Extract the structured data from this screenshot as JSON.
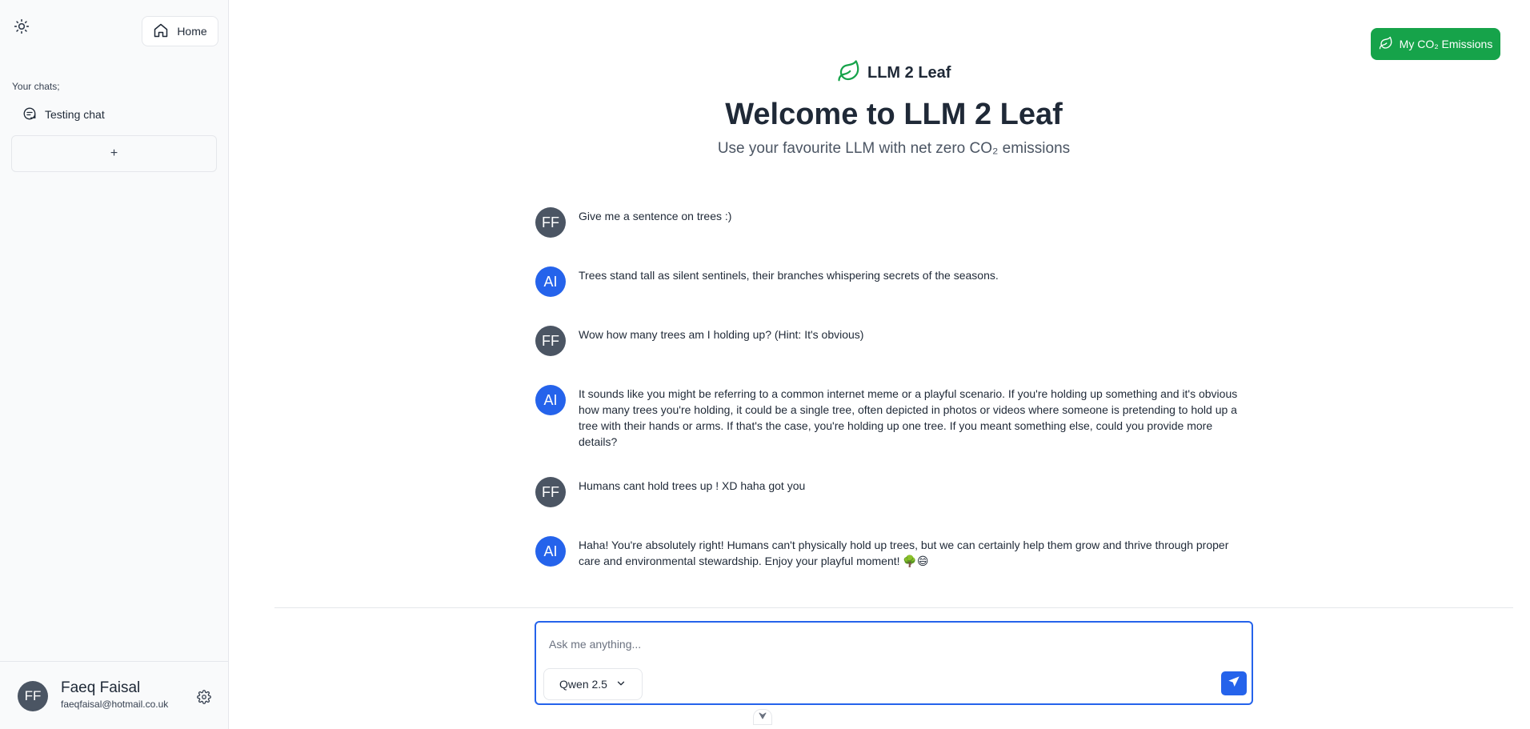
{
  "sidebar": {
    "home_label": "Home",
    "chats_label": "Your chats;",
    "chats": [
      {
        "title": "Testing chat"
      }
    ],
    "new_chat_label": "+",
    "user": {
      "initials": "FF",
      "name": "Faeq Faisal",
      "email": "faeqfaisal@hotmail.co.uk"
    }
  },
  "header": {
    "emissions_label": "My CO₂ Emissions",
    "brand_name": "LLM 2 Leaf",
    "title": "Welcome to LLM 2 Leaf",
    "subtitle": "Use your favourite LLM with net zero CO₂ emissions"
  },
  "messages": [
    {
      "role": "user",
      "avatar": "FF",
      "text": "Give me a sentence on trees :)"
    },
    {
      "role": "ai",
      "avatar": "AI",
      "text": "Trees stand tall as silent sentinels, their branches whispering secrets of the seasons."
    },
    {
      "role": "user",
      "avatar": "FF",
      "text": "Wow how many trees am I holding up? (Hint: It's obvious)"
    },
    {
      "role": "ai",
      "avatar": "AI",
      "text": "It sounds like you might be referring to a common internet meme or a playful scenario. If you're holding up something and it's obvious how many trees you're holding, it could be a single tree, often depicted in photos or videos where someone is pretending to hold up a tree with their hands or arms. If that's the case, you're holding up one tree. If you meant something else, could you provide more details?"
    },
    {
      "role": "user",
      "avatar": "FF",
      "text": "Humans cant hold trees up ! XD haha got you"
    },
    {
      "role": "ai",
      "avatar": "AI",
      "text": "Haha! You're absolutely right! Humans can't physically hold up trees, but we can certainly help them grow and thrive through proper care and environmental stewardship. Enjoy your playful moment! 🌳😄"
    }
  ],
  "composer": {
    "placeholder": "Ask me anything...",
    "value": "",
    "model": "Qwen 2.5"
  },
  "colors": {
    "accent": "#2563eb",
    "brand_green": "#16a34a",
    "user_avatar": "#4b5563"
  }
}
